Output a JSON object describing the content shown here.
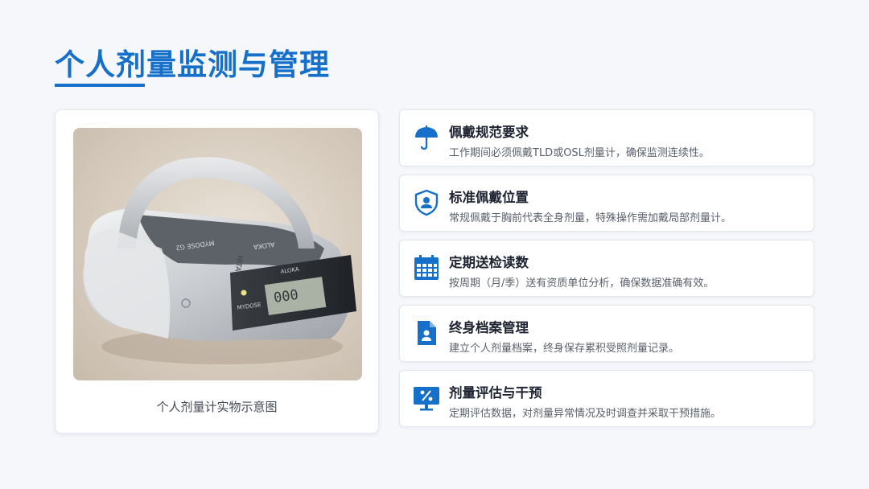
{
  "page": {
    "title": "个人剂量监测与管理",
    "accent_color": "#1670c9"
  },
  "image_panel": {
    "caption": "个人剂量计实物示意图",
    "device_brand": "HITACHI",
    "device_model": "MYDOSE G2",
    "device_label_front": "MYDOSE",
    "device_label_aloka": "ALOKA",
    "device_display": "000"
  },
  "items": [
    {
      "icon": "umbrella-icon",
      "title": "佩戴规范要求",
      "desc": "工作期间必须佩戴TLD或OSL剂量计，确保监测连续性。"
    },
    {
      "icon": "shield-user-icon",
      "title": "标准佩戴位置",
      "desc": "常规佩戴于胸前代表全身剂量，特殊操作需加戴局部剂量计。"
    },
    {
      "icon": "calendar-icon",
      "title": "定期送检读数",
      "desc": "按周期（月/季）送有资质单位分析，确保数据准确有效。"
    },
    {
      "icon": "file-user-icon",
      "title": "终身档案管理",
      "desc": "建立个人剂量档案，终身保存累积受照剂量记录。"
    },
    {
      "icon": "monitor-percent-icon",
      "title": "剂量评估与干预",
      "desc": "定期评估数据，对剂量异常情况及时调查并采取干预措施。"
    }
  ]
}
